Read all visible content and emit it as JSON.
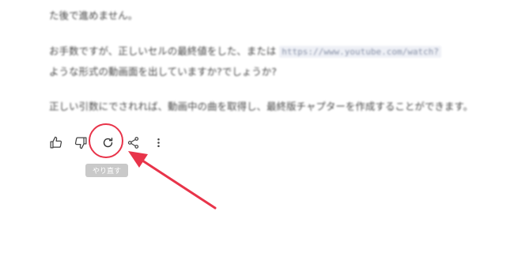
{
  "message": {
    "line1": "た後で進めません。",
    "line2_text": "お手数ですが、正しいセルの最終値をした、または",
    "line2_url": "https://www.youtube.com/watch?",
    "line3": "ような形式の動画面を出していますか?でしょうか?",
    "line4": "正しい引数にでされれば、動画中の曲を取得し、最終版チャプターを作成することができます。"
  },
  "actions": {
    "like": "thumbs-up-icon",
    "dislike": "thumbs-down-icon",
    "regenerate": "refresh-icon",
    "share": "share-icon",
    "more": "more-vertical-icon"
  },
  "tooltip": {
    "label": "やり直す"
  },
  "annotation": {
    "color": "#e8344a"
  }
}
